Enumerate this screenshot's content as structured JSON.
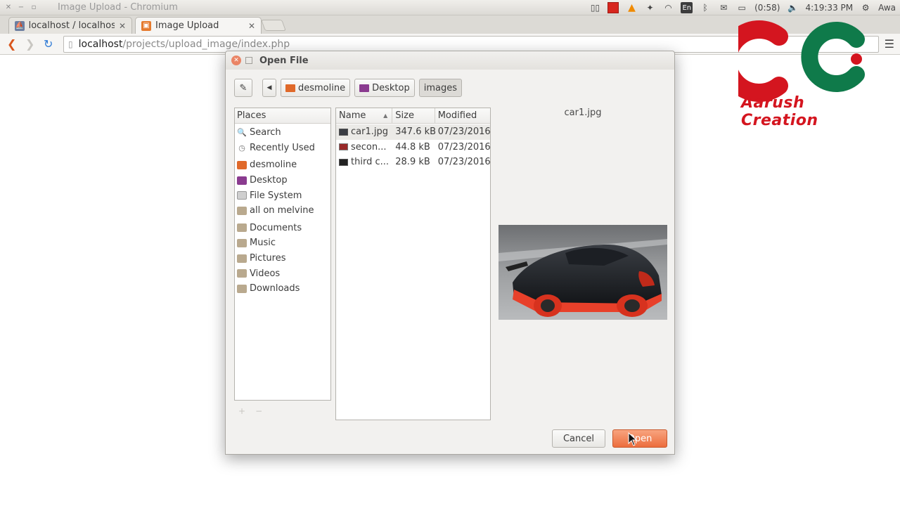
{
  "window": {
    "title": "Image Upload - Chromium"
  },
  "tray": {
    "battery": "(0:58)",
    "time": "4:19:33 PM",
    "user": "Awa",
    "keyboard": "En"
  },
  "tabs": [
    {
      "label": "localhost / localhost",
      "active": false
    },
    {
      "label": "Image Upload",
      "active": true
    }
  ],
  "address": {
    "host": "localhost",
    "path": "/projects/upload_image/index.php"
  },
  "dialog": {
    "title": "Open File",
    "pathbar": [
      "desmoline",
      "Desktop",
      "images"
    ],
    "places_header": "Places",
    "places": [
      {
        "label": "Search",
        "icon": "search-icon"
      },
      {
        "label": "Recently Used",
        "icon": "recent-icon"
      },
      {
        "label": "desmoline",
        "icon": "home-folder-icon"
      },
      {
        "label": "Desktop",
        "icon": "desktop-icon"
      },
      {
        "label": "File System",
        "icon": "drive-icon"
      },
      {
        "label": "all on melvine",
        "icon": "network-folder-icon"
      },
      {
        "label": "Documents",
        "icon": "folder-icon"
      },
      {
        "label": "Music",
        "icon": "music-folder-icon"
      },
      {
        "label": "Pictures",
        "icon": "pictures-folder-icon"
      },
      {
        "label": "Videos",
        "icon": "videos-folder-icon"
      },
      {
        "label": "Downloads",
        "icon": "downloads-folder-icon"
      }
    ],
    "columns": {
      "name": "Name",
      "size": "Size",
      "modified": "Modified"
    },
    "files": [
      {
        "name": "car1.jpg",
        "size": "347.6 kB",
        "modified": "07/23/2016",
        "selected": true
      },
      {
        "name": "secon...",
        "size": "44.8 kB",
        "modified": "07/23/2016",
        "selected": false
      },
      {
        "name": "third c...",
        "size": "28.9 kB",
        "modified": "07/23/2016",
        "selected": false
      }
    ],
    "preview_name": "car1.jpg",
    "cancel_label": "Cancel",
    "open_label": "Open"
  },
  "watermark": {
    "text": "Aarush Creation"
  },
  "colors": {
    "accent": "#ec6d3d",
    "logo_red": "#d4151f",
    "logo_green": "#0f7a4a"
  }
}
